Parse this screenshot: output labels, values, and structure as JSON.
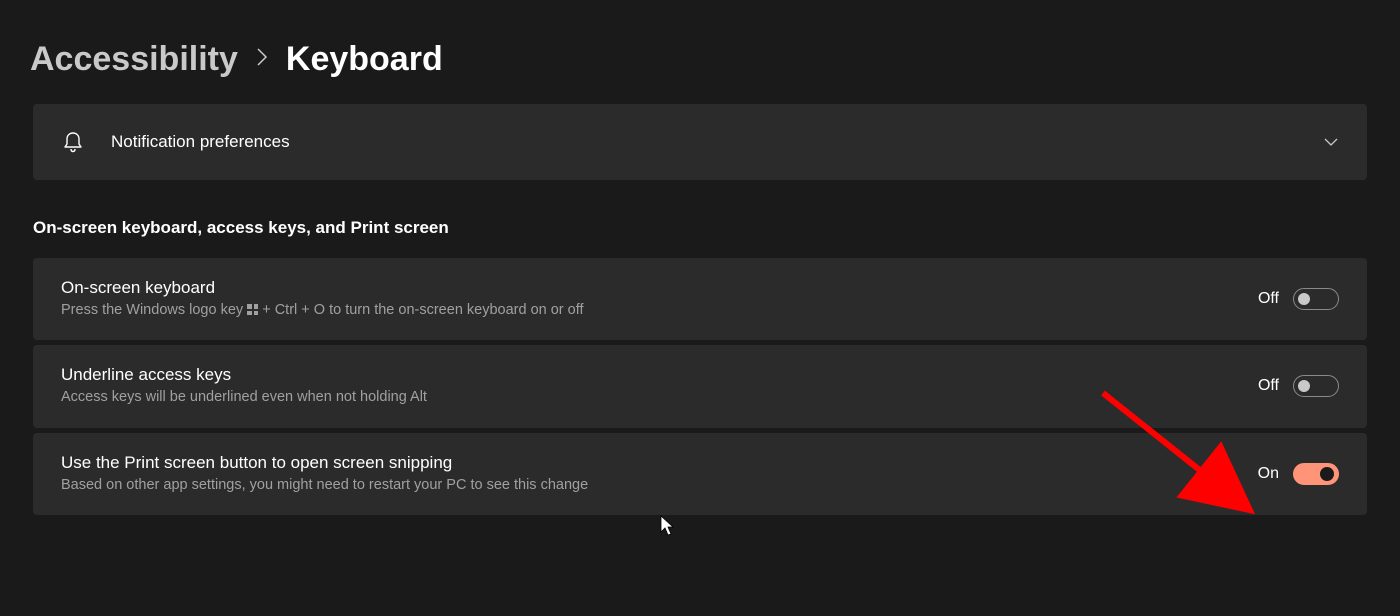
{
  "breadcrumb": {
    "parent": "Accessibility",
    "current": "Keyboard"
  },
  "notification_card": {
    "label": "Notification preferences"
  },
  "section_heading": "On-screen keyboard, access keys, and Print screen",
  "settings": [
    {
      "title": "On-screen keyboard",
      "desc_pre": "Press the Windows logo key ",
      "desc_post": " + Ctrl + O to turn the on-screen keyboard on or off",
      "state": "Off",
      "on": false
    },
    {
      "title": "Underline access keys",
      "desc": "Access keys will be underlined even when not holding Alt",
      "state": "Off",
      "on": false
    },
    {
      "title": "Use the Print screen button to open screen snipping",
      "desc": "Based on other app settings, you might need to restart your PC to see this change",
      "state": "On",
      "on": true
    }
  ]
}
